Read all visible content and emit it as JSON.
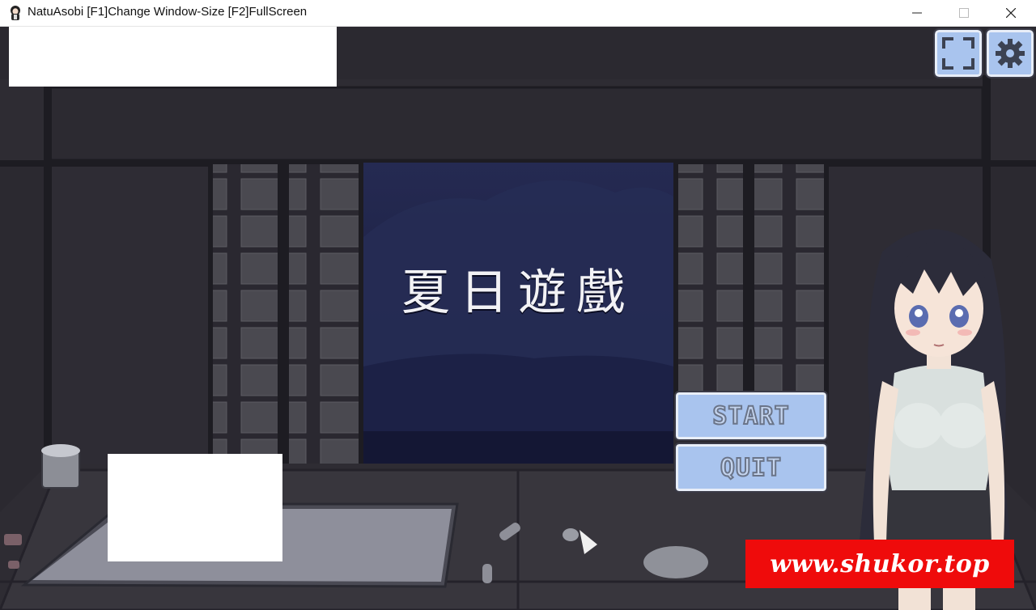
{
  "window": {
    "title": "NatuAsobi [F1]Change Window-Size [F2]FullScreen",
    "icon": "anime-girl-app-icon",
    "controls": [
      "minimize",
      "maximize",
      "close"
    ]
  },
  "game": {
    "title": "夏日遊戲",
    "menu": {
      "start_label": "START",
      "quit_label": "QUIT"
    },
    "hud": {
      "fullscreen_icon": "fullscreen-icon",
      "settings_icon": "gear-icon"
    }
  },
  "watermark": {
    "text": "www.shukor.top"
  },
  "colors": {
    "button_fill": "#a9c4ee",
    "watermark_bg": "#ef0b0b",
    "night_sky": "#1e2348"
  }
}
